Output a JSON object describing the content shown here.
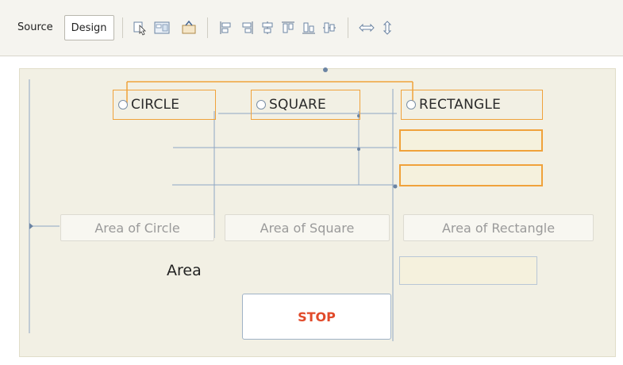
{
  "toolbar": {
    "tabs": [
      {
        "label": "Source",
        "active": false
      },
      {
        "label": "Design",
        "active": true
      }
    ],
    "icons": [
      "selection-mode-icon",
      "preview-design-icon",
      "connection-mode-icon",
      "align-left-icon",
      "align-right-icon",
      "center-horizontal-icon",
      "align-top-icon",
      "align-bottom-icon",
      "center-vertical-icon",
      "change-horizontal-resizability-icon",
      "change-vertical-resizability-icon"
    ]
  },
  "form": {
    "radios": [
      {
        "label": "CIRCLE",
        "selected": false
      },
      {
        "label": "SQUARE",
        "selected": false
      },
      {
        "label": "RECTANGLE",
        "selected": false
      }
    ],
    "buttons": {
      "area_circle": "Area of Circle",
      "area_square": "Area of Square",
      "area_rectangle": "Area of Rectangle"
    },
    "area_label": "Area",
    "stop_label": "STOP"
  },
  "colors": {
    "selection": "#f0a23b",
    "canvas": "#f2f0e4",
    "stop_text": "#e14a2a",
    "guide": "#8ea6c4"
  }
}
